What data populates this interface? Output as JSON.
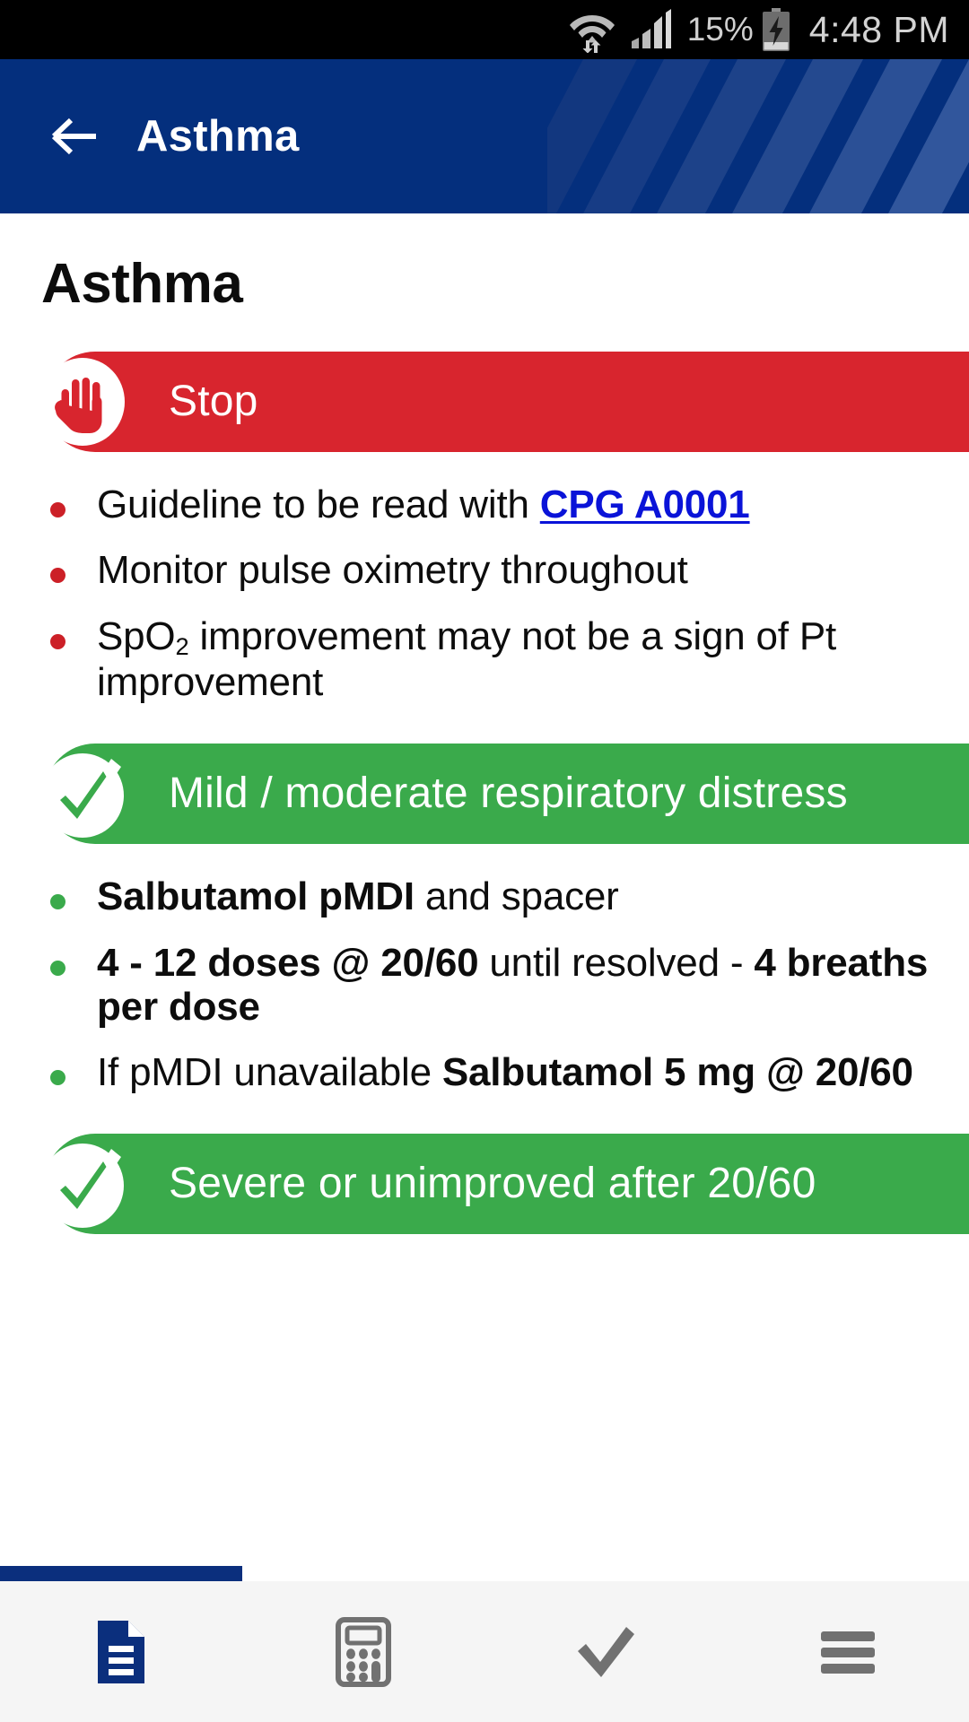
{
  "statusbar": {
    "battery_percent": "15%",
    "time": "4:48 PM",
    "wifi_icon": "wifi-data-transfer-icon",
    "signal_icon": "cellular-signal-icon",
    "battery_icon": "battery-charging-icon"
  },
  "appbar": {
    "title": "Asthma",
    "back_icon": "back-arrow-icon",
    "background_color": "#042f7d"
  },
  "page": {
    "title": "Asthma"
  },
  "sections": [
    {
      "banner": {
        "label": "Stop",
        "type": "stop",
        "color": "#d8252e",
        "icon": "stop-hand-icon"
      },
      "bullets": [
        {
          "dot_color": "#cc2027",
          "segments": [
            {
              "text": "Guideline to be read with ",
              "style": "normal"
            },
            {
              "text": "CPG A0001",
              "style": "link"
            }
          ]
        },
        {
          "dot_color": "#cc2027",
          "segments": [
            {
              "text": "Monitor pulse oximetry throughout",
              "style": "normal"
            }
          ]
        },
        {
          "dot_color": "#cc2027",
          "segments": [
            {
              "text": "SpO",
              "style": "normal"
            },
            {
              "text": "2",
              "style": "subscript"
            },
            {
              "text": " improvement may not be a sign of Pt improvement",
              "style": "normal"
            }
          ]
        }
      ]
    },
    {
      "banner": {
        "label": "Mild / moderate respiratory distress",
        "type": "check",
        "color": "#3aaa4b",
        "icon": "check-circle-icon"
      },
      "bullets": [
        {
          "dot_color": "#3aaa4b",
          "segments": [
            {
              "text": "Salbutamol pMDI",
              "style": "bold"
            },
            {
              "text": " and spacer",
              "style": "normal"
            }
          ]
        },
        {
          "dot_color": "#3aaa4b",
          "segments": [
            {
              "text": "4 - 12 doses @ 20/60",
              "style": "bold"
            },
            {
              "text": " until resolved - ",
              "style": "normal"
            },
            {
              "text": "4 breaths per dose",
              "style": "bold"
            }
          ]
        },
        {
          "dot_color": "#3aaa4b",
          "segments": [
            {
              "text": "If pMDI unavailable ",
              "style": "normal"
            },
            {
              "text": "Salbutamol 5 mg @ 20/60",
              "style": "bold"
            }
          ]
        }
      ]
    },
    {
      "banner": {
        "label": "Severe or unimproved after 20/60",
        "type": "check",
        "color": "#3aaa4b",
        "icon": "check-circle-icon"
      },
      "bullets": []
    }
  ],
  "bottomnav": {
    "indicator_color": "#0b2f7d",
    "items": [
      {
        "name": "document",
        "icon": "document-icon",
        "active": true,
        "color": "#0b2f7d"
      },
      {
        "name": "calculator",
        "icon": "calculator-icon",
        "active": false,
        "color": "#717171"
      },
      {
        "name": "checklist",
        "icon": "check-icon",
        "active": false,
        "color": "#717171"
      },
      {
        "name": "menu",
        "icon": "hamburger-menu-icon",
        "active": false,
        "color": "#717171"
      }
    ]
  }
}
